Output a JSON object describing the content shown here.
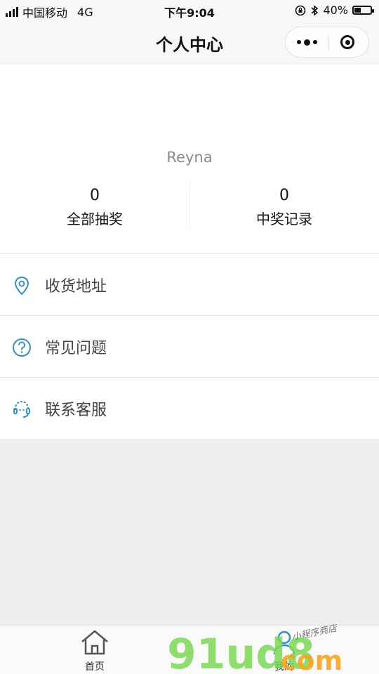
{
  "status_bar": {
    "carrier": "中国移动",
    "network": "4G",
    "time": "下午9:04",
    "battery_percent": "40%",
    "battery_level": 0.4
  },
  "navbar": {
    "title": "个人中心"
  },
  "profile": {
    "username": "Reyna",
    "stats": [
      {
        "value": "0",
        "label": "全部抽奖"
      },
      {
        "value": "0",
        "label": "中奖记录"
      }
    ]
  },
  "menu": {
    "items": [
      {
        "label": "收货地址",
        "icon": "location-pin-icon"
      },
      {
        "label": "常见问题",
        "icon": "question-circle-icon"
      },
      {
        "label": "联系客服",
        "icon": "headset-icon"
      }
    ]
  },
  "tabbar": {
    "tabs": [
      {
        "label": "首页",
        "icon": "home-icon"
      },
      {
        "label": "我的",
        "icon": "user-icon"
      }
    ]
  },
  "watermark": {
    "brand": "91ud8",
    "suffix": "com",
    "tagline": "小程序商店"
  },
  "colors": {
    "icon_accent": "#3a8fc2",
    "watermark_green": "#7ed957",
    "watermark_orange": "#f5a623",
    "page_background": "#efefef"
  }
}
